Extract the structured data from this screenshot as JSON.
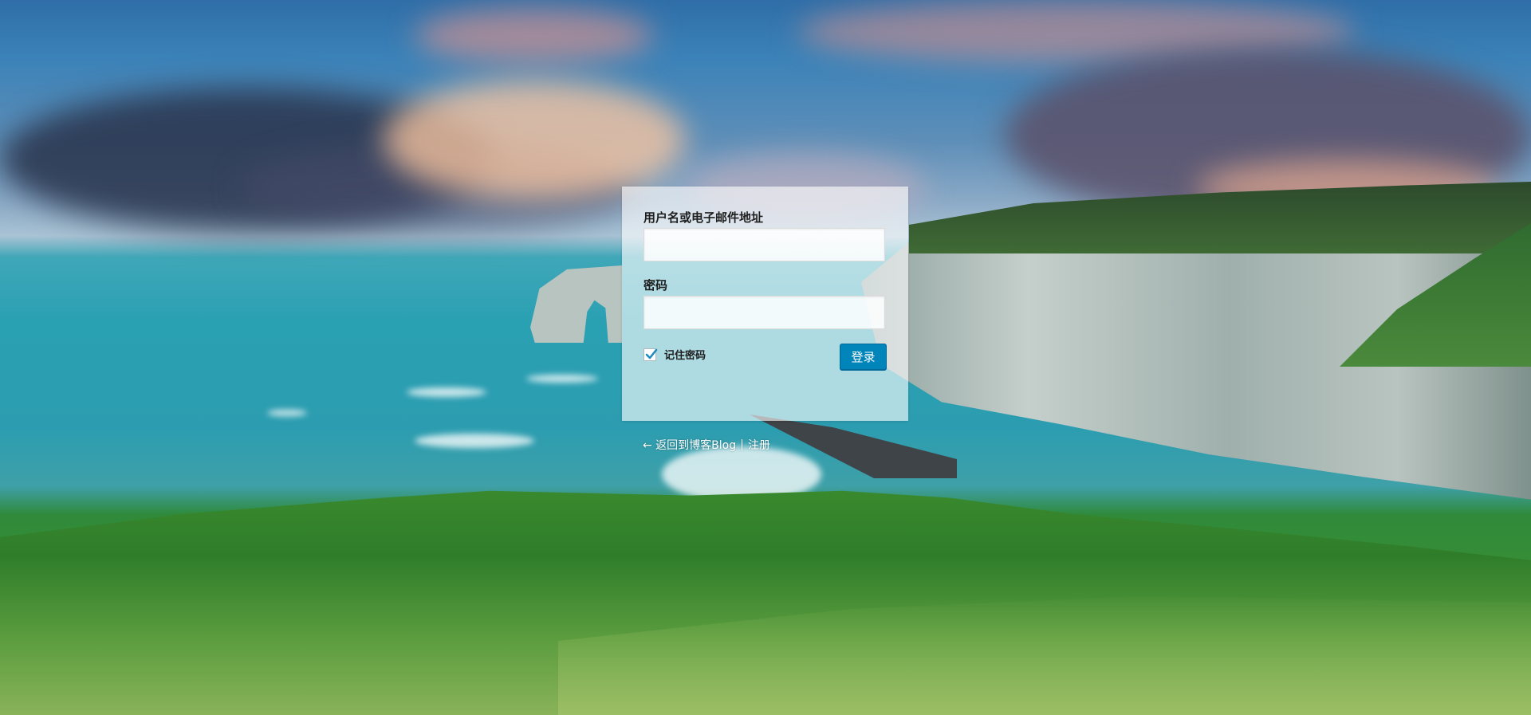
{
  "form": {
    "username_label": "用户名或电子邮件地址",
    "username_value": "",
    "password_label": "密码",
    "password_value": "",
    "remember_label": "记住密码",
    "remember_checked": true,
    "submit_label": "登录"
  },
  "footer_links": {
    "back_link": "← 返回到博客Blog",
    "separator": "|",
    "register_link": "注册"
  },
  "colors": {
    "button": "#0085ba",
    "checkmark": "#1e8cbe"
  },
  "background": {
    "icon": "coastal-cliffs-photo"
  }
}
